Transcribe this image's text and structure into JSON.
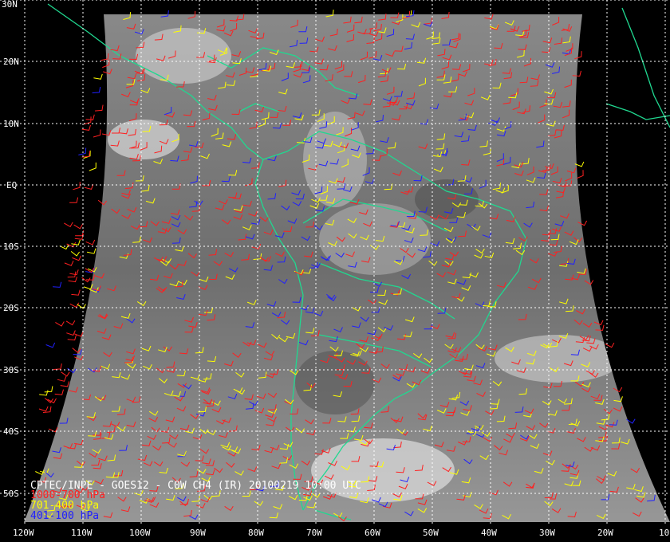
{
  "lat_labels": [
    "30N",
    "20N",
    "10N",
    "EQ",
    "10S",
    "20S",
    "30S",
    "40S",
    "50S"
  ],
  "lon_labels": [
    "120W",
    "110W",
    "100W",
    "90W",
    "80W",
    "70W",
    "60W",
    "50W",
    "40W",
    "30W",
    "20W",
    "10"
  ],
  "caption": {
    "title": "CPTEC/INPE - GOES12 - C0W CH4 (IR) 20100219 10:00 UTC",
    "legend": [
      {
        "label": "1000-700 hPa",
        "color": "#ff2020"
      },
      {
        "label": "701-400 hPa",
        "color": "#ffff00"
      },
      {
        "label": "401-100 hPa",
        "color": "#2020ff"
      }
    ]
  },
  "colors": {
    "coastline": "#20d890",
    "grid": "#ffffff",
    "background": "#000000"
  }
}
